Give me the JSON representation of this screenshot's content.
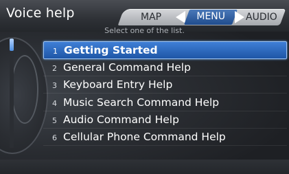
{
  "header": {
    "title": "Voice help",
    "instruction": "Select one of the list."
  },
  "tabs": [
    {
      "label": "MAP"
    },
    {
      "label": "MENU",
      "selected": true
    },
    {
      "label": "AUDIO"
    }
  ],
  "list": {
    "items": [
      {
        "num": "1",
        "label": "Getting Started",
        "selected": true
      },
      {
        "num": "2",
        "label": "General Command Help"
      },
      {
        "num": "3",
        "label": "Keyboard Entry Help"
      },
      {
        "num": "4",
        "label": "Music Search Command Help"
      },
      {
        "num": "5",
        "label": "Audio Command Help"
      },
      {
        "num": "6",
        "label": "Cellular Phone Command Help"
      }
    ]
  },
  "colors": {
    "selected_bg": "#2f6cc2",
    "background": "#2a2d32"
  },
  "icons": {
    "left_arrow": "arrow-left-icon",
    "right_arrow": "arrow-right-icon"
  }
}
